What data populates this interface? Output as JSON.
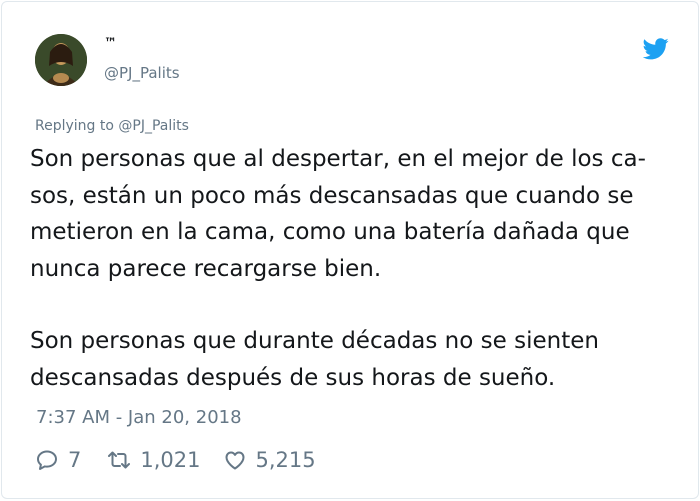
{
  "author": {
    "display_name": "™",
    "handle": "@PJ_Palits",
    "avatar_icon": "portrait-avatar"
  },
  "brand": {
    "icon": "twitter-bird-icon",
    "color": "#1da1f2"
  },
  "replying_to": "Replying to @PJ_Palits",
  "tweet": {
    "paragraph_1": [
      "Son personas que al despertar, en el mejor de los ca-",
      "sos, están un poco más descansadas que cuando se",
      "metieron en la cama, como una batería dañada que",
      "nunca parece recargarse bien."
    ],
    "paragraph_2": [
      "Son personas que durante décadas no se sienten",
      "descansadas después de sus horas de sueño."
    ]
  },
  "timestamp": "7:37 AM - Jan 20, 2018",
  "actions": {
    "replies": "7",
    "retweets": "1,021",
    "likes": "5,215",
    "icons": [
      "reply-icon",
      "retweet-icon",
      "like-heart-icon"
    ]
  },
  "colors": {
    "text": "#14171a",
    "secondary": "#657786",
    "border": "#e1e8ed"
  }
}
